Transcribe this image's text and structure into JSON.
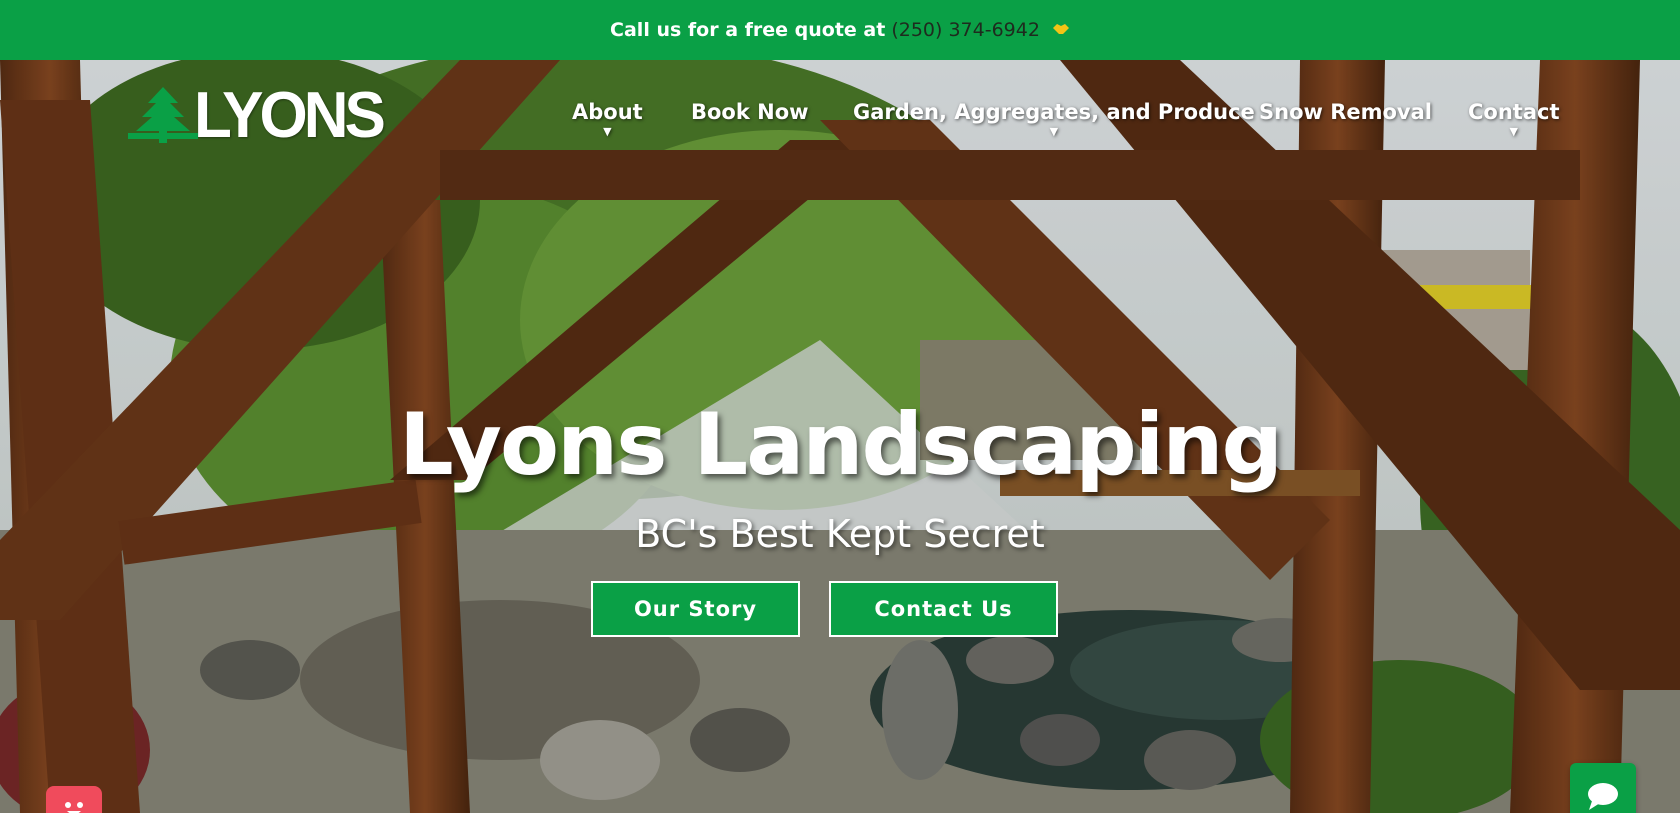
{
  "topbar": {
    "text": "Call us for a free quote at",
    "phone": "(250) 374-6942",
    "icon": "handshake-icon"
  },
  "brand": {
    "logo_text": "LYONS",
    "logo_icon": "pine-tree-icon"
  },
  "nav": {
    "items": [
      {
        "label": "About",
        "has_dropdown": true
      },
      {
        "label": "Book Now",
        "has_dropdown": false
      },
      {
        "label": "Garden, Aggregates, and Produce",
        "has_dropdown": true
      },
      {
        "label": "Snow Removal",
        "has_dropdown": false
      },
      {
        "label": "Contact",
        "has_dropdown": true
      }
    ]
  },
  "hero": {
    "title": "Lyons Landscaping",
    "subtitle": "BC's Best Kept Secret",
    "buttons": [
      {
        "label": "Our Story"
      },
      {
        "label": "Contact Us"
      }
    ]
  },
  "widgets": {
    "chat_icon": "chat-bubble-icon",
    "assistant_icon": "smiley-face-icon"
  },
  "colors": {
    "brand_green": "#0aa046",
    "phone_text": "#1e2b1e",
    "assistant_red": "#f04b5c"
  }
}
